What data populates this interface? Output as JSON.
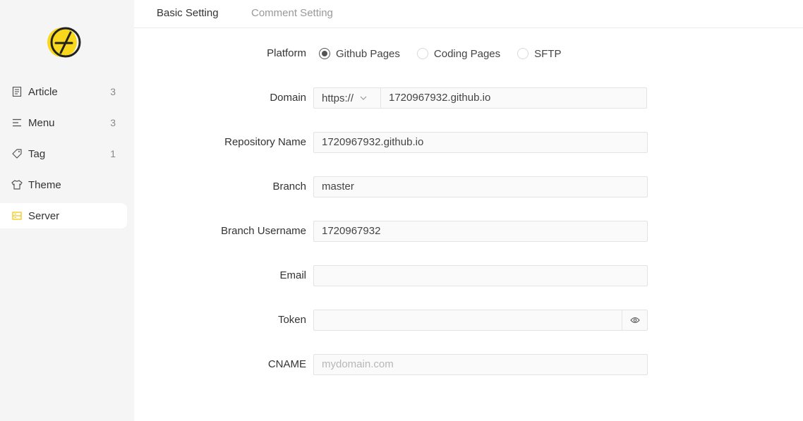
{
  "sidebar": {
    "items": [
      {
        "label": "Article",
        "count": "3",
        "icon": "file-text-icon"
      },
      {
        "label": "Menu",
        "count": "3",
        "icon": "menu-icon"
      },
      {
        "label": "Tag",
        "count": "1",
        "icon": "tag-icon"
      },
      {
        "label": "Theme",
        "count": "",
        "icon": "shirt-icon"
      },
      {
        "label": "Server",
        "count": "",
        "icon": "server-icon"
      }
    ],
    "active": "Server"
  },
  "tabs": [
    {
      "label": "Basic Setting",
      "active": true
    },
    {
      "label": "Comment Setting",
      "active": false
    }
  ],
  "form": {
    "platform": {
      "label": "Platform",
      "options": [
        "Github Pages",
        "Coding Pages",
        "SFTP"
      ],
      "selected": "Github Pages"
    },
    "domain": {
      "label": "Domain",
      "protocol": "https://",
      "value": "1720967932.github.io"
    },
    "repository": {
      "label": "Repository Name",
      "value": "1720967932.github.io"
    },
    "branch": {
      "label": "Branch",
      "value": "master"
    },
    "username": {
      "label": "Branch Username",
      "value": "1720967932"
    },
    "email": {
      "label": "Email",
      "value": ""
    },
    "token": {
      "label": "Token",
      "value": ""
    },
    "cname": {
      "label": "CNAME",
      "value": "",
      "placeholder": "mydomain.com"
    }
  },
  "colors": {
    "accent": "#f9d71c",
    "sidebar_bg": "#f5f5f5"
  }
}
